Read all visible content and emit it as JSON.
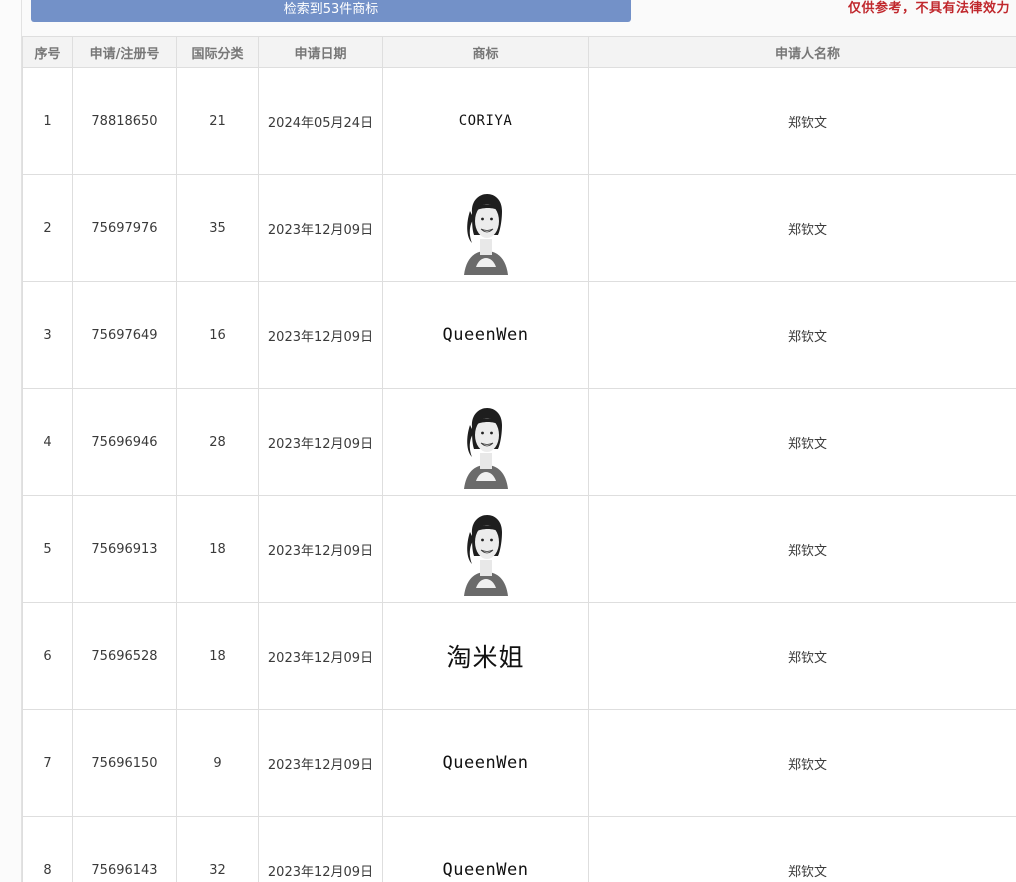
{
  "header": {
    "result_label": "检索到53件商标",
    "disclaimer": "仅供参考，不具有法律效力"
  },
  "table": {
    "columns": [
      "序号",
      "申请/注册号",
      "国际分类",
      "申请日期",
      "商标",
      "申请人名称"
    ],
    "rows": [
      {
        "no": "1",
        "reg": "78818650",
        "cls": "21",
        "date": "2024年05月24日",
        "mark_type": "text",
        "mark": "CORIYA",
        "applicant": "郑钦文"
      },
      {
        "no": "2",
        "reg": "75697976",
        "cls": "35",
        "date": "2023年12月09日",
        "mark_type": "image",
        "mark": "portrait-image",
        "applicant": "郑钦文"
      },
      {
        "no": "3",
        "reg": "75697649",
        "cls": "16",
        "date": "2023年12月09日",
        "mark_type": "text",
        "mark": "QueenWen",
        "applicant": "郑钦文"
      },
      {
        "no": "4",
        "reg": "75696946",
        "cls": "28",
        "date": "2023年12月09日",
        "mark_type": "image",
        "mark": "portrait-image",
        "applicant": "郑钦文"
      },
      {
        "no": "5",
        "reg": "75696913",
        "cls": "18",
        "date": "2023年12月09日",
        "mark_type": "image",
        "mark": "portrait-image",
        "applicant": "郑钦文"
      },
      {
        "no": "6",
        "reg": "75696528",
        "cls": "18",
        "date": "2023年12月09日",
        "mark_type": "text",
        "mark": "淘米姐",
        "applicant": "郑钦文"
      },
      {
        "no": "7",
        "reg": "75696150",
        "cls": "9",
        "date": "2023年12月09日",
        "mark_type": "text",
        "mark": "QueenWen",
        "applicant": "郑钦文"
      },
      {
        "no": "8",
        "reg": "75696143",
        "cls": "32",
        "date": "2023年12月09日",
        "mark_type": "text",
        "mark": "QueenWen",
        "applicant": "郑钦文"
      }
    ]
  }
}
